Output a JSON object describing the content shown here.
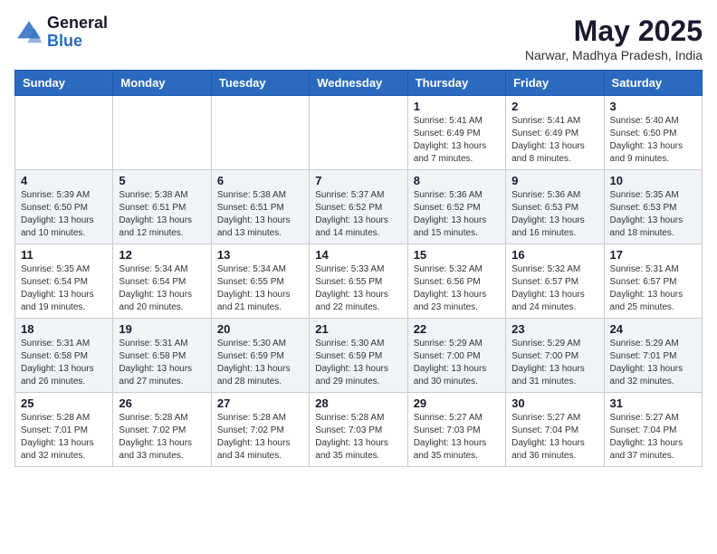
{
  "header": {
    "logo_general": "General",
    "logo_blue": "Blue",
    "month_year": "May 2025",
    "location": "Narwar, Madhya Pradesh, India"
  },
  "days_of_week": [
    "Sunday",
    "Monday",
    "Tuesday",
    "Wednesday",
    "Thursday",
    "Friday",
    "Saturday"
  ],
  "weeks": [
    [
      {
        "day": "",
        "info": ""
      },
      {
        "day": "",
        "info": ""
      },
      {
        "day": "",
        "info": ""
      },
      {
        "day": "",
        "info": ""
      },
      {
        "day": "1",
        "info": "Sunrise: 5:41 AM\nSunset: 6:49 PM\nDaylight: 13 hours\nand 7 minutes."
      },
      {
        "day": "2",
        "info": "Sunrise: 5:41 AM\nSunset: 6:49 PM\nDaylight: 13 hours\nand 8 minutes."
      },
      {
        "day": "3",
        "info": "Sunrise: 5:40 AM\nSunset: 6:50 PM\nDaylight: 13 hours\nand 9 minutes."
      }
    ],
    [
      {
        "day": "4",
        "info": "Sunrise: 5:39 AM\nSunset: 6:50 PM\nDaylight: 13 hours\nand 10 minutes."
      },
      {
        "day": "5",
        "info": "Sunrise: 5:38 AM\nSunset: 6:51 PM\nDaylight: 13 hours\nand 12 minutes."
      },
      {
        "day": "6",
        "info": "Sunrise: 5:38 AM\nSunset: 6:51 PM\nDaylight: 13 hours\nand 13 minutes."
      },
      {
        "day": "7",
        "info": "Sunrise: 5:37 AM\nSunset: 6:52 PM\nDaylight: 13 hours\nand 14 minutes."
      },
      {
        "day": "8",
        "info": "Sunrise: 5:36 AM\nSunset: 6:52 PM\nDaylight: 13 hours\nand 15 minutes."
      },
      {
        "day": "9",
        "info": "Sunrise: 5:36 AM\nSunset: 6:53 PM\nDaylight: 13 hours\nand 16 minutes."
      },
      {
        "day": "10",
        "info": "Sunrise: 5:35 AM\nSunset: 6:53 PM\nDaylight: 13 hours\nand 18 minutes."
      }
    ],
    [
      {
        "day": "11",
        "info": "Sunrise: 5:35 AM\nSunset: 6:54 PM\nDaylight: 13 hours\nand 19 minutes."
      },
      {
        "day": "12",
        "info": "Sunrise: 5:34 AM\nSunset: 6:54 PM\nDaylight: 13 hours\nand 20 minutes."
      },
      {
        "day": "13",
        "info": "Sunrise: 5:34 AM\nSunset: 6:55 PM\nDaylight: 13 hours\nand 21 minutes."
      },
      {
        "day": "14",
        "info": "Sunrise: 5:33 AM\nSunset: 6:55 PM\nDaylight: 13 hours\nand 22 minutes."
      },
      {
        "day": "15",
        "info": "Sunrise: 5:32 AM\nSunset: 6:56 PM\nDaylight: 13 hours\nand 23 minutes."
      },
      {
        "day": "16",
        "info": "Sunrise: 5:32 AM\nSunset: 6:57 PM\nDaylight: 13 hours\nand 24 minutes."
      },
      {
        "day": "17",
        "info": "Sunrise: 5:31 AM\nSunset: 6:57 PM\nDaylight: 13 hours\nand 25 minutes."
      }
    ],
    [
      {
        "day": "18",
        "info": "Sunrise: 5:31 AM\nSunset: 6:58 PM\nDaylight: 13 hours\nand 26 minutes."
      },
      {
        "day": "19",
        "info": "Sunrise: 5:31 AM\nSunset: 6:58 PM\nDaylight: 13 hours\nand 27 minutes."
      },
      {
        "day": "20",
        "info": "Sunrise: 5:30 AM\nSunset: 6:59 PM\nDaylight: 13 hours\nand 28 minutes."
      },
      {
        "day": "21",
        "info": "Sunrise: 5:30 AM\nSunset: 6:59 PM\nDaylight: 13 hours\nand 29 minutes."
      },
      {
        "day": "22",
        "info": "Sunrise: 5:29 AM\nSunset: 7:00 PM\nDaylight: 13 hours\nand 30 minutes."
      },
      {
        "day": "23",
        "info": "Sunrise: 5:29 AM\nSunset: 7:00 PM\nDaylight: 13 hours\nand 31 minutes."
      },
      {
        "day": "24",
        "info": "Sunrise: 5:29 AM\nSunset: 7:01 PM\nDaylight: 13 hours\nand 32 minutes."
      }
    ],
    [
      {
        "day": "25",
        "info": "Sunrise: 5:28 AM\nSunset: 7:01 PM\nDaylight: 13 hours\nand 32 minutes."
      },
      {
        "day": "26",
        "info": "Sunrise: 5:28 AM\nSunset: 7:02 PM\nDaylight: 13 hours\nand 33 minutes."
      },
      {
        "day": "27",
        "info": "Sunrise: 5:28 AM\nSunset: 7:02 PM\nDaylight: 13 hours\nand 34 minutes."
      },
      {
        "day": "28",
        "info": "Sunrise: 5:28 AM\nSunset: 7:03 PM\nDaylight: 13 hours\nand 35 minutes."
      },
      {
        "day": "29",
        "info": "Sunrise: 5:27 AM\nSunset: 7:03 PM\nDaylight: 13 hours\nand 35 minutes."
      },
      {
        "day": "30",
        "info": "Sunrise: 5:27 AM\nSunset: 7:04 PM\nDaylight: 13 hours\nand 36 minutes."
      },
      {
        "day": "31",
        "info": "Sunrise: 5:27 AM\nSunset: 7:04 PM\nDaylight: 13 hours\nand 37 minutes."
      }
    ]
  ]
}
